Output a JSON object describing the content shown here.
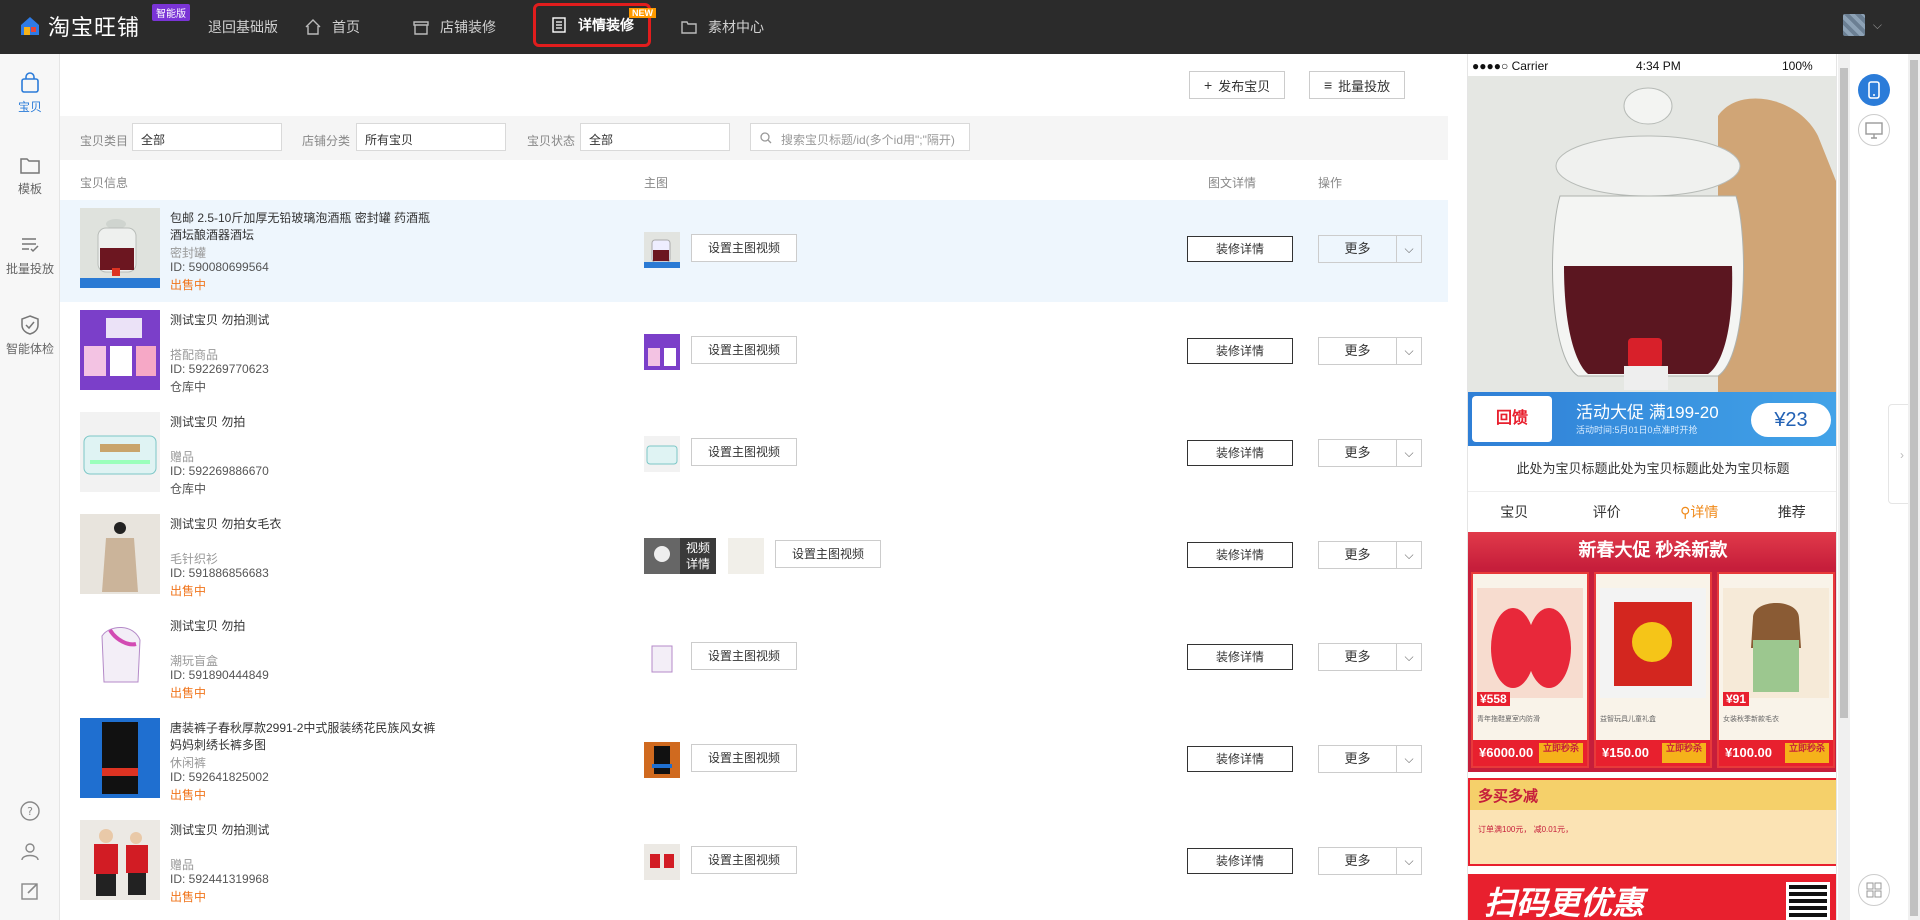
{
  "topbar": {
    "logo_text": "淘宝旺铺",
    "smart_badge": "智能版",
    "nav": [
      {
        "label": "退回基础版"
      },
      {
        "label": "首页"
      },
      {
        "label": "店铺装修"
      },
      {
        "label": "详情装修",
        "badge": "NEW",
        "active": true
      },
      {
        "label": "素材中心"
      }
    ],
    "user_chevron": "⌵"
  },
  "sidebar": {
    "items": [
      {
        "label": "宝贝",
        "icon": "bag-icon",
        "active": true
      },
      {
        "label": "模板",
        "icon": "folder-icon"
      },
      {
        "label": "批量投放",
        "icon": "list-check-icon"
      },
      {
        "label": "智能体检",
        "icon": "shield-check-icon"
      }
    ],
    "bottom_icons": [
      "help-icon",
      "user-icon",
      "edit-icon"
    ]
  },
  "toolbar": {
    "publish_label": "发布宝贝",
    "batch_label": "批量投放"
  },
  "filters": {
    "category_label": "宝贝类目",
    "category_value": "全部",
    "shop_category_label": "店铺分类",
    "shop_category_value": "所有宝贝",
    "status_label": "宝贝状态",
    "status_value": "全部",
    "search_placeholder": "搜索宝贝标题/id(多个id用\";\"隔开)"
  },
  "table": {
    "headers": [
      "宝贝信息",
      "主图",
      "图文详情",
      "操作"
    ],
    "set_video_label": "设置主图视频",
    "decorate_label": "装修详情",
    "more_label": "更多",
    "video_detail_label_1": "视频",
    "video_detail_label_2": "详情",
    "rows": [
      {
        "title": "包邮 2.5-10斤加厚无铅玻璃泡酒瓶 密封罐 药酒瓶 酒坛酿酒器酒坛",
        "category": "密封罐",
        "id": "ID: 590080699564",
        "status": "出售中",
        "status_type": "sale"
      },
      {
        "title": "测试宝贝 勿拍测试",
        "category": "搭配商品",
        "id": "ID: 592269770623",
        "status": "仓库中",
        "status_type": "store"
      },
      {
        "title": "测试宝贝 勿拍",
        "category": "赠品",
        "id": "ID: 592269886670",
        "status": "仓库中",
        "status_type": "store"
      },
      {
        "title": "测试宝贝 勿拍女毛衣",
        "category": "毛针织衫",
        "id": "ID: 591886856683",
        "status": "出售中",
        "status_type": "sale"
      },
      {
        "title": "测试宝贝 勿拍",
        "category": "潮玩盲盒",
        "id": "ID: 591890444849",
        "status": "出售中",
        "status_type": "sale"
      },
      {
        "title": "唐装裤子春秋厚款2991-2中式服装绣花民族风女裤妈妈刺绣长裤多图",
        "category": "休闲裤",
        "id": "ID: 592641825002",
        "status": "出售中",
        "status_type": "sale"
      },
      {
        "title": "测试宝贝 勿拍测试",
        "category": "赠品",
        "id": "ID: 592441319968",
        "status": "出售中",
        "status_type": "sale"
      }
    ]
  },
  "preview": {
    "statusbar": {
      "carrier": "●●●●○ Carrier",
      "time": "4:34 PM",
      "battery": "100%"
    },
    "promo_badge": "回馈",
    "promo_text": "活动大促 满199-20",
    "promo_sub": "活动时间:5月01日0点准时开抢",
    "promo_price": "¥23",
    "product_title": "此处为宝贝标题此处为宝贝标题此处为宝贝标题",
    "tabs": [
      "宝贝",
      "评价",
      "详情",
      "推荐"
    ],
    "active_tab": "详情",
    "sale_head": "新春大促  秒杀新款",
    "cards": [
      {
        "coupon": "¥558",
        "price": "¥6000.00",
        "btn": "立即秒杀",
        "desc": "青年拖鞋夏室内防滑"
      },
      {
        "coupon": "",
        "price": "¥150.00",
        "btn": "立即秒杀",
        "desc": "益智玩具儿童礼盒"
      },
      {
        "coupon": "¥91",
        "price": "¥100.00",
        "btn": "立即秒杀",
        "desc": "女装秋季新款毛衣"
      }
    ],
    "buy_title": "多买多减",
    "buy_line": "订单满100元， 减0.01元，",
    "scan_text": "扫码更优惠"
  }
}
